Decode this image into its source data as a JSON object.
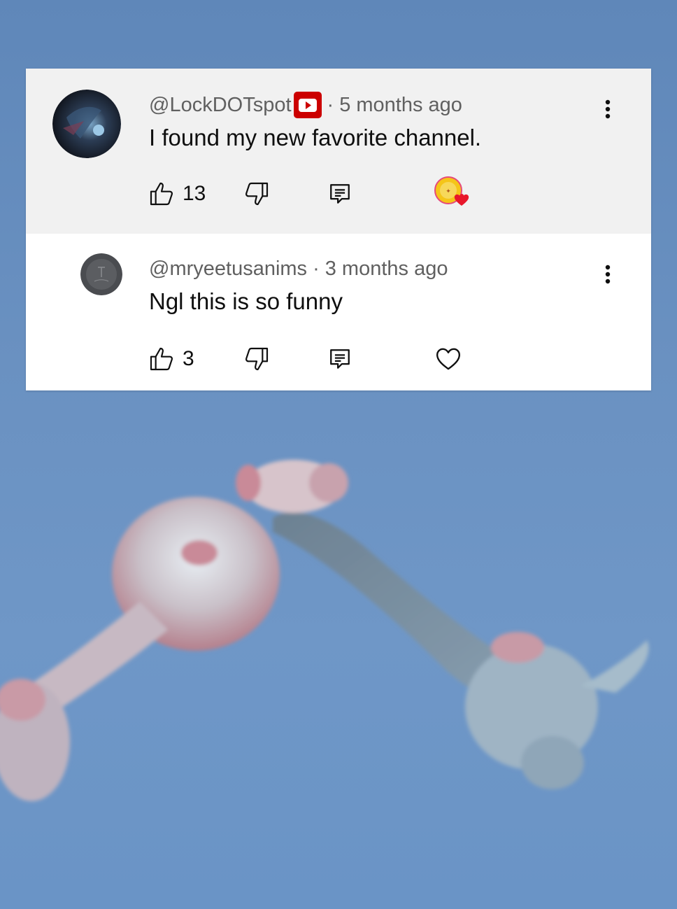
{
  "comments": [
    {
      "handle": "@LockDOTspot",
      "separator": "·",
      "time": "5 months ago",
      "text": "I found my new favorite channel.",
      "likes": "13",
      "verified_badge_icon": "youtube-play-icon",
      "hearted": true,
      "colors": {
        "badge": "#cc0000",
        "heart": "#e8172b",
        "creator_avatar": "#f5c518"
      }
    },
    {
      "handle": "@mryeetusanims",
      "separator": "·",
      "time": "3 months ago",
      "text": "Ngl this is so funny",
      "likes": "3",
      "hearted": false
    }
  ],
  "icons": {
    "like": "thumbs-up-icon",
    "dislike": "thumbs-down-icon",
    "reply": "reply-icon",
    "heart": "heart-icon",
    "more": "more-vertical-icon"
  }
}
